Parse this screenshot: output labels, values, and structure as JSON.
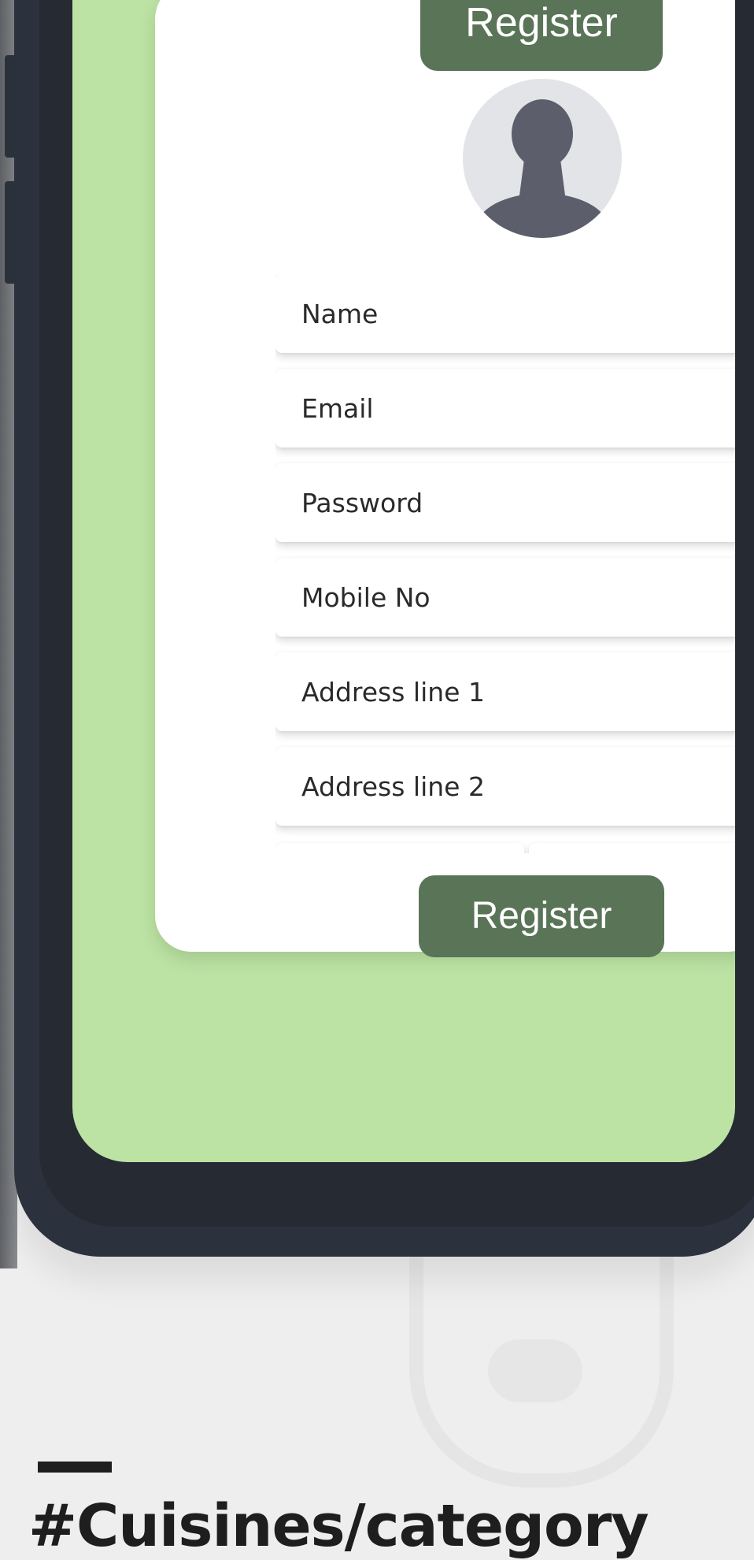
{
  "header": {
    "title": "Register"
  },
  "form": {
    "fields": [
      {
        "placeholder": "Name"
      },
      {
        "placeholder": "Email"
      },
      {
        "placeholder": "Password"
      },
      {
        "placeholder": "Mobile No"
      },
      {
        "placeholder": "Address line 1"
      },
      {
        "placeholder": "Address line 2"
      }
    ],
    "submit_label": "Register"
  },
  "avatar": {
    "icon": "user-silhouette-icon"
  },
  "caption": "#Cuisines/category",
  "colors": {
    "screen_bg": "#bce3a3",
    "button": "#5a7457",
    "phone_frame": "#2c323d",
    "avatar_bg": "#e3e4e7",
    "avatar_figure": "#5c5f6b"
  }
}
